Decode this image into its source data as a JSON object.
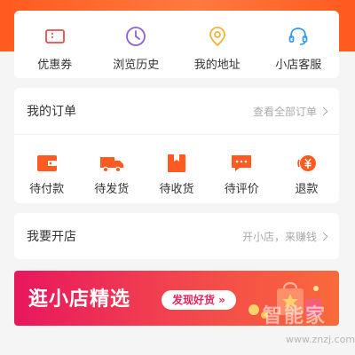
{
  "services": [
    {
      "label": "优惠券",
      "icon": "coupon-icon"
    },
    {
      "label": "浏览历史",
      "icon": "clock-icon"
    },
    {
      "label": "我的地址",
      "icon": "location-pin-icon"
    },
    {
      "label": "小店客服",
      "icon": "headset-icon"
    }
  ],
  "orders": {
    "title": "我的订单",
    "view_all": "查看全部订单",
    "items": [
      {
        "label": "待付款",
        "icon": "wallet-icon"
      },
      {
        "label": "待发货",
        "icon": "truck-icon"
      },
      {
        "label": "待收货",
        "icon": "box-icon"
      },
      {
        "label": "待评价",
        "icon": "comment-icon"
      },
      {
        "label": "退款",
        "icon": "refund-icon"
      }
    ]
  },
  "shop": {
    "title": "我要开店",
    "link": "开小店，来赚钱"
  },
  "banner": {
    "title": "逛小店精选",
    "button": "发现好货 »"
  },
  "watermark": {
    "name": "智能家",
    "url": "www.znzj.com"
  },
  "colors": {
    "accent": "#ff5a1f",
    "service_icon_red": "#e94b4b",
    "service_icon_purple": "#8a63d2",
    "service_icon_yellow": "#f0b43c",
    "service_icon_blue": "#3b9ae8",
    "order_icon": "#ff5a1f"
  }
}
